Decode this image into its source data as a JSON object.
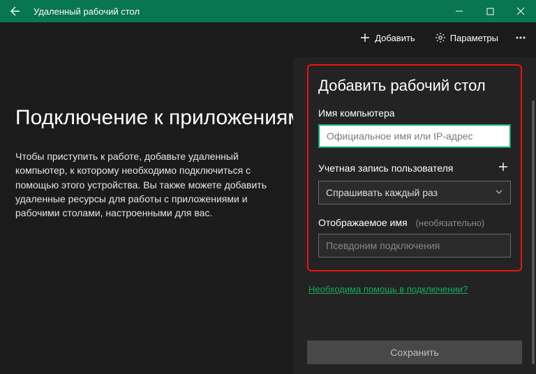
{
  "titlebar": {
    "title": "Удаленный рабочий стол"
  },
  "toolbar": {
    "add": "Добавить",
    "settings": "Параметры"
  },
  "main": {
    "heading": "Подключение к приложениям",
    "paragraph": "Чтобы приступить к работе, добавьте удаленный компьютер, к которому необходимо подключиться с помощью этого устройства. Вы также можете добавить удаленные ресурсы для работы с приложениями и рабочими столами, настроенными для вас."
  },
  "panel": {
    "title": "Добавить рабочий стол",
    "pcname_label": "Имя компьютера",
    "pcname_placeholder": "Официальное имя или IP-адрес",
    "account_label": "Учетная запись пользователя",
    "account_value": "Спрашивать каждый раз",
    "display_label": "Отображаемое имя",
    "display_hint": "(необязательно)",
    "display_placeholder": "Псевдоним подключения",
    "help_link": "Необходима помощь в подключении?",
    "save": "Сохранить"
  }
}
